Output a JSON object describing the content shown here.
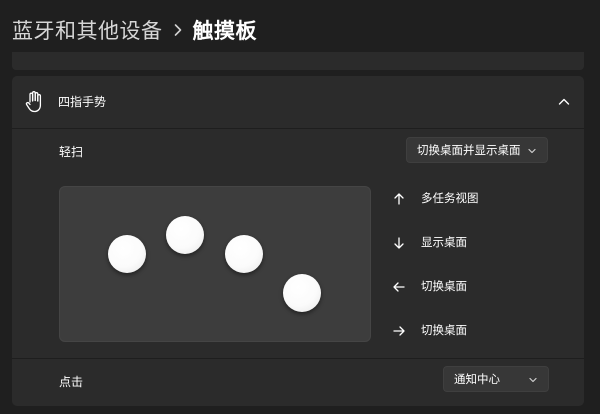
{
  "breadcrumb": {
    "parent": "蓝牙和其他设备",
    "separator_icon": "chevron-right-icon",
    "current": "触摸板"
  },
  "four_finger_gestures": {
    "icon": "hand-gesture-icon",
    "title": "四指手势",
    "expanded": true,
    "collapse_icon": "chevron-up-icon",
    "swipe": {
      "label": "轻扫",
      "selected": "切换桌面并显示桌面"
    },
    "directions": [
      {
        "icon": "arrow-up-icon",
        "label": "多任务视图"
      },
      {
        "icon": "arrow-down-icon",
        "label": "显示桌面"
      },
      {
        "icon": "arrow-left-icon",
        "label": "切换桌面"
      },
      {
        "icon": "arrow-right-icon",
        "label": "切换桌面"
      }
    ],
    "tap": {
      "label": "点击",
      "selected": "通知中心"
    }
  },
  "colors": {
    "background": "#1f1f1f",
    "card": "#2b2b2b",
    "dropdown": "#373737",
    "touchpad": "#3d3d3d",
    "finger": "#ffffff"
  }
}
